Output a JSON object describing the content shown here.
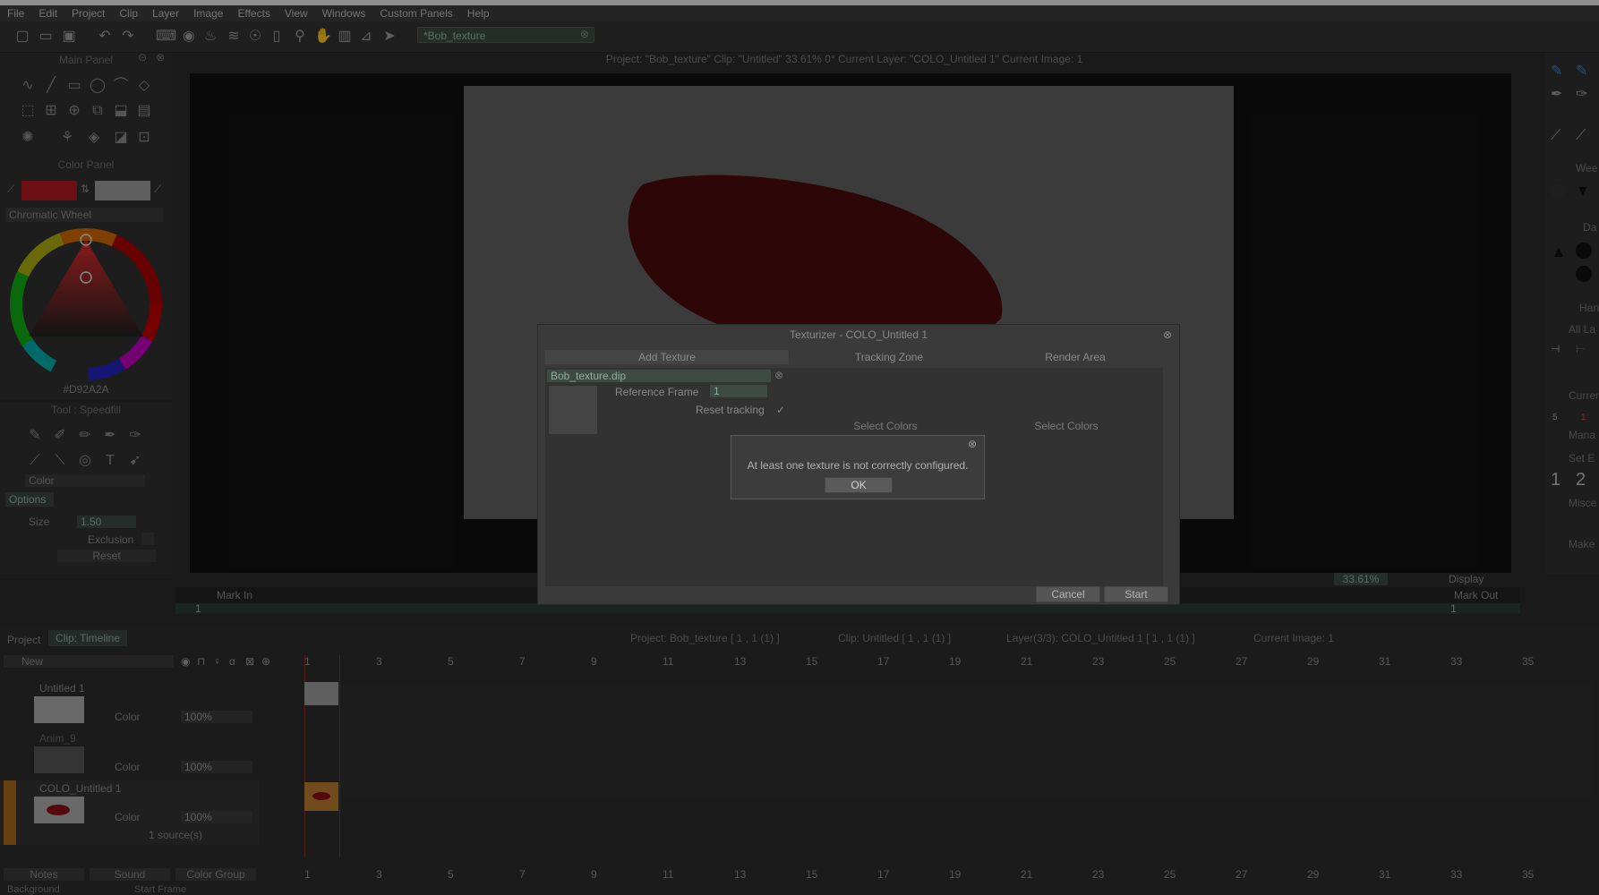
{
  "menu": [
    "File",
    "Edit",
    "Project",
    "Clip",
    "Layer",
    "Image",
    "Effects",
    "View",
    "Windows",
    "Custom Panels",
    "Help"
  ],
  "search": {
    "value": "*Bob_texture"
  },
  "viewer": {
    "info": "Project:  \"Bob_texture\"  Clip: \"Untitled\"   33.61%   0°   Current Layer: \"COLO_Untitled 1\"  Current Image: 1",
    "zoom": "33.61%",
    "display": "Display",
    "mark_in": "Mark In",
    "mark_out": "Mark Out",
    "in_value": "1",
    "out_value": "1"
  },
  "main_panel": {
    "title": "Main Panel"
  },
  "color_panel": {
    "title": "Color Panel",
    "mode": "Chromatic Wheel",
    "hex": "#D92A2A",
    "primary": "#b01a1f",
    "secondary": "#9a9a9a"
  },
  "tool_panel": {
    "title": "Tool : Speedfill",
    "mode": "Color",
    "options": "Options",
    "size_label": "Size",
    "size_value": "1.50",
    "exclusion": "Exclusion",
    "reset": "Reset"
  },
  "texturizer": {
    "title": "Texturizer - COLO_Untitled 1",
    "tabs": [
      "Add Texture",
      "Tracking Zone",
      "Render Area"
    ],
    "file": "Bob_texture.dip",
    "ref_label": "Reference Frame",
    "ref_value": "1",
    "reset_label": "Reset tracking",
    "reset_check": "✓",
    "select_colors_1": "Select Colors",
    "select_colors_2": "Select Colors",
    "cancel": "Cancel",
    "start": "Start"
  },
  "alert": {
    "message": "At least one texture is not correctly configured.",
    "ok": "OK"
  },
  "timeline": {
    "tabs": [
      "Project",
      "Clip: Timeline"
    ],
    "info": [
      "Project: Bob_texture [ 1 , 1  (1) ]",
      "Clip: Untitled [ 1 , 1  (1) ]",
      "Layer(3/3): COLO_Untitled 1 [ 1 , 1  (1) ]",
      "Current Image: 1"
    ],
    "new_label": "New",
    "frames": [
      "1",
      "3",
      "5",
      "7",
      "9",
      "11",
      "13",
      "15",
      "17",
      "19",
      "21",
      "23",
      "25",
      "27",
      "29",
      "31",
      "33",
      "35"
    ],
    "layers": [
      {
        "name": "Untitled 1",
        "mode": "Color",
        "opacity": "100%"
      },
      {
        "name": "Anim_9",
        "mode": "Color",
        "opacity": "100%"
      },
      {
        "name": "COLO_Untitled 1",
        "mode": "Color",
        "opacity": "100%",
        "sources": "1 source(s)"
      }
    ],
    "bottom_tabs": [
      "Notes",
      "Sound",
      "Color Group"
    ],
    "bottom_row": [
      "Background",
      "Start Frame"
    ]
  },
  "right_panel": {
    "labels": [
      "Wee",
      "Da",
      "Hand",
      "All La",
      "Curren",
      "Mana",
      "Set E",
      "Misce",
      "Make"
    ],
    "nums": [
      "1",
      "2"
    ],
    "small": [
      "5",
      "1"
    ]
  }
}
